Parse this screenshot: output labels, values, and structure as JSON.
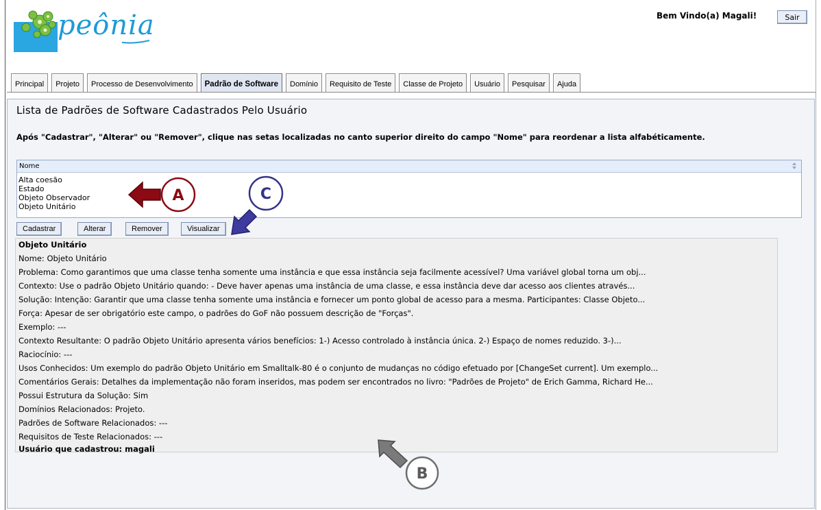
{
  "header": {
    "logo_text": "peônia",
    "welcome": "Bem Vindo(a) Magali!",
    "logout_label": "Sair"
  },
  "tabs": [
    {
      "label": "Principal",
      "active": false
    },
    {
      "label": "Projeto",
      "active": false
    },
    {
      "label": "Processo de Desenvolvimento",
      "active": false
    },
    {
      "label": "Padrão de Software",
      "active": true
    },
    {
      "label": "Domínio",
      "active": false
    },
    {
      "label": "Requisito de Teste",
      "active": false
    },
    {
      "label": "Classe de Projeto",
      "active": false
    },
    {
      "label": "Usuário",
      "active": false
    },
    {
      "label": "Pesquisar",
      "active": false
    },
    {
      "label": "Ajuda",
      "active": false
    }
  ],
  "main": {
    "title": "Lista de Padrões de Software Cadastrados Pelo Usuário",
    "instructions": "Após \"Cadastrar\", \"Alterar\" ou \"Remover\", clique nas setas localizadas no canto superior direito do campo \"Nome\" para reordenar a lista alfabéticamente.",
    "list": {
      "header": "Nome",
      "items": [
        "Alta coesão",
        "Estado",
        "Objeto Observador",
        "Objeto Unitário"
      ]
    },
    "buttons": {
      "cadastrar": "Cadastrar",
      "alterar": "Alterar",
      "remover": "Remover",
      "visualizar": "Visualizar"
    },
    "details": {
      "heading": "Objeto Unitário",
      "lines": [
        "Nome: Objeto Unitário",
        "Problema: Como garantimos que uma classe tenha somente uma instância e que essa instância seja facilmente acessível? Uma variável global torna um obj...",
        "Contexto: Use o padrão Objeto Unitário quando: - Deve haver apenas uma instância de uma classe, e essa instância deve dar acesso aos clientes através...",
        "Solução: Intenção: Garantir que uma classe tenha somente uma instância e fornecer um ponto global de acesso para a mesma. Participantes: Classe Objeto...",
        "Força: Apesar de ser obrigatório este campo, o padrões do GoF não possuem descrição de \"Forças\".",
        "Exemplo: ---",
        "Contexto Resultante: O padrão Objeto Unitário apresenta vários benefícios: 1-) Acesso controlado à instância única. 2-) Espaço de nomes reduzido. 3-)...",
        "Raciocínio: ---",
        "Usos Conhecidos: Um exemplo do padrão Objeto Unitário em Smalltalk-80 é o conjunto de mudanças no código efetuado por [ChangeSet current]. Um exemplo...",
        "Comentários Gerais: Detalhes da implementação não foram inseridos, mas podem ser encontrados no livro: \"Padrões de Projeto\" de Erich Gamma, Richard He...",
        "Possui Estrutura da Solução: Sim",
        "Domínios Relacionados: Projeto.",
        "Padrões de Software Relacionados: ---",
        "Requisitos de Teste Relacionados: ---"
      ],
      "footer": "Usuário que cadastrou: magali"
    }
  },
  "annotations": {
    "a": "A",
    "b": "B",
    "c": "C"
  },
  "colors": {
    "arrow_a": "#8b0a14",
    "arrow_b": "#6e6e6e",
    "arrow_c": "#33328a",
    "logo_blue": "#1e9ad6",
    "logo_green": "#5aa02c"
  }
}
